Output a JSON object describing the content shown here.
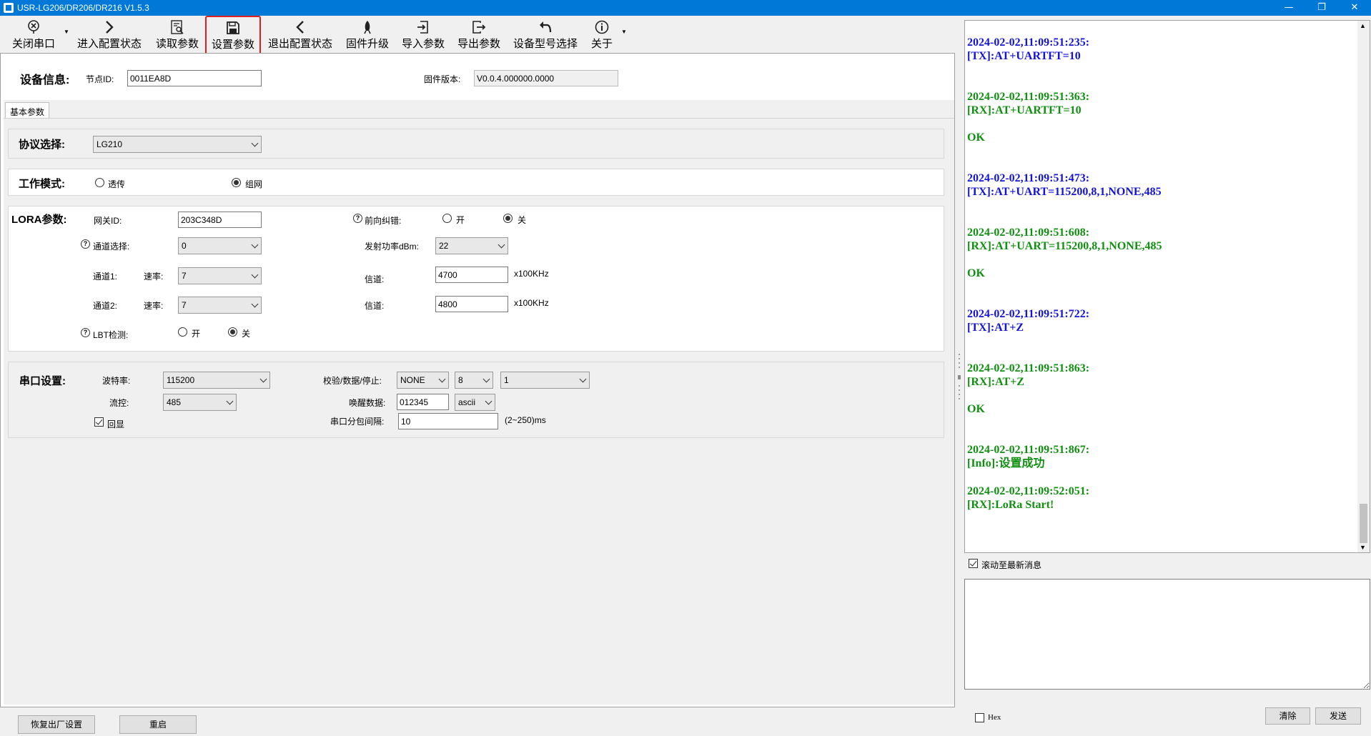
{
  "window": {
    "title": "USR-LG206/DR206/DR216 V1.5.3",
    "minimize": "—",
    "restore": "❐",
    "close": "✕"
  },
  "toolbar": {
    "close_port": "关闭串口",
    "enter_config": "进入配置状态",
    "read_params": "读取参数",
    "set_params": "设置参数",
    "exit_config": "退出配置状态",
    "firmware_upgrade": "固件升级",
    "import_params": "导入参数",
    "export_params": "导出参数",
    "device_model": "设备型号选择",
    "about": "关于"
  },
  "device_info": {
    "title": "设备信息:",
    "node_id_label": "节点ID:",
    "node_id": "0011EA8D",
    "firmware_label": "固件版本:",
    "firmware": "V0.0.4.000000.0000"
  },
  "tabs": {
    "basic": "基本参数"
  },
  "protocol": {
    "title": "协议选择:",
    "value": "LG210"
  },
  "work_mode": {
    "title": "工作模式:",
    "transparent": "透传",
    "network": "组网",
    "selected": "组网"
  },
  "lora": {
    "title": "LORA参数:",
    "gateway_id_label": "网关ID:",
    "gateway_id": "203C348D",
    "fec_label": "前向纠错:",
    "fec_on": "开",
    "fec_off": "关",
    "fec_selected": "关",
    "channel_select_label": "通道选择:",
    "channel_select": "0",
    "tx_power_label": "发射功率dBm:",
    "tx_power": "22",
    "ch1_label": "通道1:",
    "rate_label": "速率:",
    "ch1_rate": "7",
    "freq_label": "信道:",
    "ch1_freq": "4700",
    "freq_unit": "x100KHz",
    "ch2_label": "通道2:",
    "ch2_rate": "7",
    "ch2_freq": "4800",
    "lbt_label": "LBT检测:",
    "lbt_on": "开",
    "lbt_off": "关",
    "lbt_selected": "关"
  },
  "serial": {
    "title": "串口设置:",
    "baud_label": "波特率:",
    "baud": "115200",
    "parity_label": "校验/数据/停止:",
    "parity": "NONE",
    "data_bits": "8",
    "stop_bits": "1",
    "flow_label": "流控:",
    "flow": "485",
    "wake_label": "唤醒数据:",
    "wake_data": "012345",
    "wake_format": "ascii",
    "echo_label": "回显",
    "echo_checked": true,
    "interval_label": "串口分包间隔:",
    "interval": "10",
    "interval_range": "(2~250)ms"
  },
  "log": [
    {
      "type": "tx",
      "text": "2024-02-02,11:09:51:235:\n[TX]:AT+UARTFT=10"
    },
    {
      "type": "rx",
      "text": "2024-02-02,11:09:51:363:\n[RX]:AT+UARTFT=10\n\nOK"
    },
    {
      "type": "tx",
      "text": "2024-02-02,11:09:51:473:\n[TX]:AT+UART=115200,8,1,NONE,485"
    },
    {
      "type": "rx",
      "text": "2024-02-02,11:09:51:608:\n[RX]:AT+UART=115200,8,1,NONE,485\n\nOK"
    },
    {
      "type": "tx",
      "text": "2024-02-02,11:09:51:722:\n[TX]:AT+Z"
    },
    {
      "type": "rx",
      "text": "2024-02-02,11:09:51:863:\n[RX]:AT+Z\n\nOK"
    },
    {
      "type": "rx",
      "text": "2024-02-02,11:09:51:867:\n[Info]:设置成功"
    },
    {
      "type": "rx",
      "text": "2024-02-02,11:09:52:051:\n[RX]:LoRa Start!"
    }
  ],
  "log_options": {
    "autoscroll_label": "滚动至最新消息",
    "autoscroll_checked": true,
    "hex_label": "Hex",
    "hex_checked": false
  },
  "bottom": {
    "factory_reset": "恢复出厂设置",
    "restart": "重启",
    "clear": "清除",
    "send": "发送"
  },
  "colors": {
    "titlebar": "#0078d7",
    "tx": "#1414d8",
    "rx": "#109010",
    "highlight": "#e02020"
  }
}
